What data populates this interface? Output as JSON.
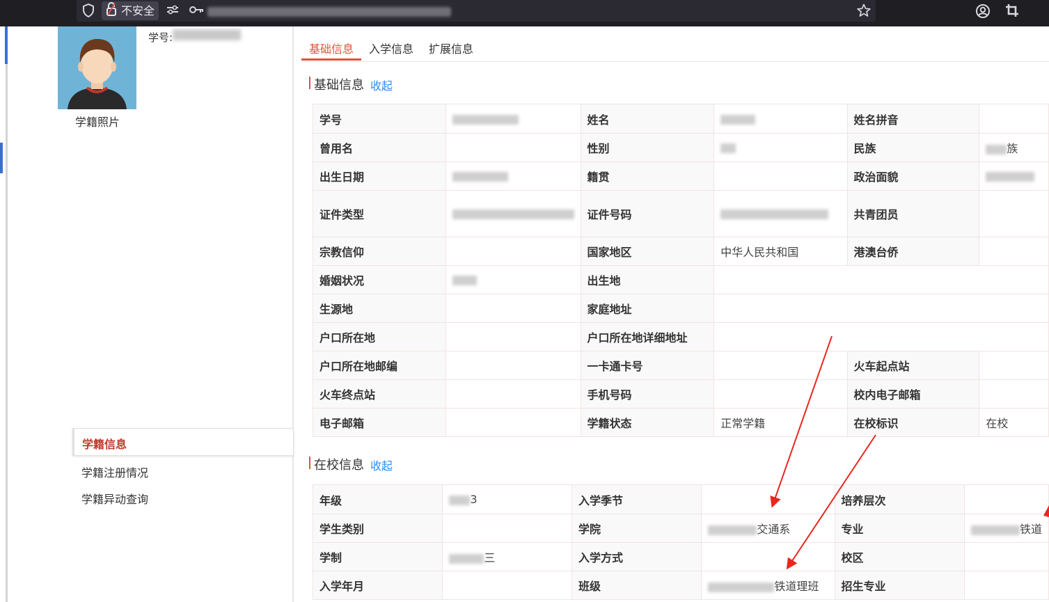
{
  "browser": {
    "insecure_label": "不安全",
    "icons": [
      "shield-icon",
      "lock-warning-icon",
      "permissions-icon",
      "key-icon",
      "star-icon",
      "account-icon",
      "crop-icon"
    ]
  },
  "student": {
    "id_label": "学号:",
    "photo_caption": "学籍照片"
  },
  "side_menu": {
    "items": [
      {
        "label": "学籍信息",
        "active": true
      },
      {
        "label": "学籍注册情况",
        "active": false
      },
      {
        "label": "学籍异动查询",
        "active": false
      }
    ]
  },
  "tabs": [
    {
      "label": "基础信息",
      "active": true
    },
    {
      "label": "入学信息",
      "active": false
    },
    {
      "label": "扩展信息",
      "active": false
    }
  ],
  "sections": {
    "basic": {
      "title": "基础信息",
      "fold_label": "收起",
      "rows": [
        [
          {
            "l": "学号",
            "v": ""
          },
          {
            "l": "姓名",
            "v": ""
          },
          {
            "l": "姓名拼音",
            "v": ""
          }
        ],
        [
          {
            "l": "曾用名",
            "v": ""
          },
          {
            "l": "性别",
            "v": ""
          },
          {
            "l": "民族",
            "v": "族"
          }
        ],
        [
          {
            "l": "出生日期",
            "v": ""
          },
          {
            "l": "籍贯",
            "v": ""
          },
          {
            "l": "政治面貌",
            "v": ""
          }
        ],
        [
          {
            "l": "证件类型",
            "v": ""
          },
          {
            "l": "证件号码",
            "v": ""
          },
          {
            "l": "共青团员",
            "v": ""
          }
        ],
        [
          {
            "l": "宗教信仰",
            "v": ""
          },
          {
            "l": "国家地区",
            "v": "中华人民共和国"
          },
          {
            "l": "港澳台侨",
            "v": ""
          }
        ],
        [
          {
            "l": "婚姻状况",
            "v": ""
          },
          {
            "l": "出生地",
            "v": ""
          }
        ],
        [
          {
            "l": "生源地",
            "v": ""
          },
          {
            "l": "家庭地址",
            "v": ""
          }
        ],
        [
          {
            "l": "户口所在地",
            "v": ""
          },
          {
            "l": "户口所在地详细地址",
            "v": ""
          }
        ],
        [
          {
            "l": "户口所在地邮编",
            "v": ""
          },
          {
            "l": "一卡通卡号",
            "v": ""
          },
          {
            "l": "火车起点站",
            "v": ""
          }
        ],
        [
          {
            "l": "火车终点站",
            "v": ""
          },
          {
            "l": "手机号码",
            "v": ""
          },
          {
            "l": "校内电子邮箱",
            "v": ""
          }
        ],
        [
          {
            "l": "电子邮箱",
            "v": ""
          },
          {
            "l": "学籍状态",
            "v": "正常学籍"
          },
          {
            "l": "在校标识",
            "v": "在校"
          }
        ]
      ]
    },
    "school": {
      "title": "在校信息",
      "fold_label": "收起",
      "rows": [
        [
          {
            "l": "年级",
            "v": "3"
          },
          {
            "l": "入学季节",
            "v": ""
          },
          {
            "l": "培养层次",
            "v": ""
          }
        ],
        [
          {
            "l": "学生类别",
            "v": ""
          },
          {
            "l": "学院",
            "v": "交通系"
          },
          {
            "l": "专业",
            "v": "铁道"
          }
        ],
        [
          {
            "l": "学制",
            "v": "三"
          },
          {
            "l": "入学方式",
            "v": ""
          },
          {
            "l": "校区",
            "v": ""
          }
        ],
        [
          {
            "l": "入学年月",
            "v": ""
          },
          {
            "l": "班级",
            "v": "铁道理班"
          },
          {
            "l": "招生专业",
            "v": ""
          }
        ]
      ]
    }
  },
  "colors": {
    "accent": "#e0533a",
    "link": "#2d8cf0",
    "annotation_arrow": "#e8281e"
  }
}
